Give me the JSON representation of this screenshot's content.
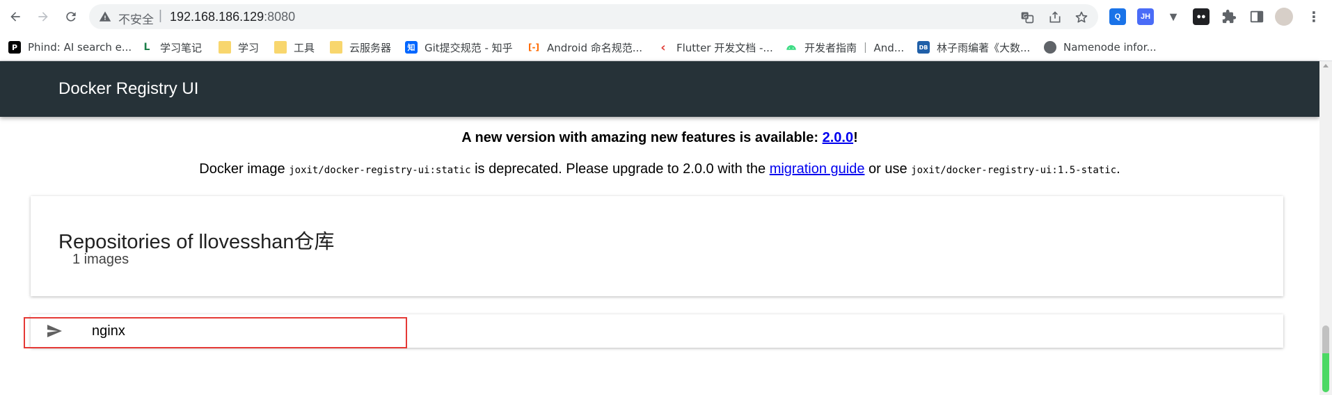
{
  "browser": {
    "security_label": "不安全",
    "separator": "|",
    "url_host": "192.168.186.129",
    "url_port": ":8080"
  },
  "bookmarks": [
    {
      "label": "Phind: AI search e...",
      "icon": "phind-icon",
      "color": "#000000",
      "glyph": "P"
    },
    {
      "label": "学习笔记",
      "icon": "note-icon",
      "color": "#1e7f4a",
      "glyph": "L"
    },
    {
      "label": "学习",
      "icon": "folder-icon",
      "color": "#f8d66d",
      "glyph": ""
    },
    {
      "label": "工具",
      "icon": "folder-icon",
      "color": "#f8d66d",
      "glyph": ""
    },
    {
      "label": "云服务器",
      "icon": "folder-icon",
      "color": "#f8d66d",
      "glyph": ""
    },
    {
      "label": "Git提交规范 - 知乎",
      "icon": "zhihu-icon",
      "color": "#0066ff",
      "glyph": "知"
    },
    {
      "label": "Android 命名规范...",
      "icon": "aliyun-icon",
      "color": "#ff6a00",
      "glyph": "[-]"
    },
    {
      "label": "Flutter 开发文档 -...",
      "icon": "flutter-icon",
      "color": "#e0403a",
      "glyph": "‹"
    },
    {
      "label": "开发者指南 ｜ And...",
      "icon": "android-icon",
      "color": "#3ddc84",
      "glyph": ""
    },
    {
      "label": "林子雨编著《大数...",
      "icon": "dblab-icon",
      "color": "#1f5fa8",
      "glyph": "DB"
    },
    {
      "label": "Namenode infor...",
      "icon": "globe-icon",
      "color": "#5f6368",
      "glyph": ""
    }
  ],
  "app": {
    "title": "Docker Registry UI"
  },
  "notice": {
    "line1_prefix": "A new version with amazing new features is available: ",
    "line1_link": "2.0.0",
    "line1_suffix": "!",
    "line2_a": "Docker image ",
    "line2_code1": "joxit/docker-registry-ui:static",
    "line2_b": " is deprecated. Please upgrade to 2.0.0 with the ",
    "line2_link": "migration guide",
    "line2_c": " or use ",
    "line2_code2": "joxit/docker-registry-ui:1.5-static",
    "line2_d": "."
  },
  "repositories": {
    "title": "Repositories of llovesshan仓库",
    "count": "1 images",
    "items": [
      {
        "name": "nginx",
        "icon": "send-icon"
      }
    ]
  }
}
